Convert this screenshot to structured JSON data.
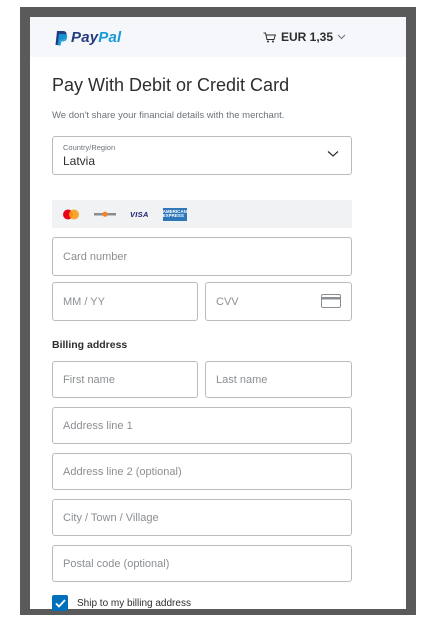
{
  "header": {
    "logo_pay": "Pay",
    "logo_pal": "Pal",
    "cart_total": "EUR 1,35",
    "colors": {
      "paypal_dark": "#253b80",
      "paypal_light": "#179bd7",
      "header_bg": "#f5f7fa"
    }
  },
  "form": {
    "title": "Pay With Debit or Credit Card",
    "subtitle": "We don't share your financial details with the merchant.",
    "country": {
      "label": "Country/Region",
      "value": "Latvia"
    },
    "card_brands": [
      "mastercard-icon",
      "discover-icon",
      "visa-icon",
      "amex-icon"
    ],
    "visa_label": "VISA",
    "amex_label": "AMERICAN EXPRESS",
    "card_number_placeholder": "Card number",
    "expiry_placeholder": "MM / YY",
    "cvv_placeholder": "CVV",
    "billing_title": "Billing address",
    "first_name_placeholder": "First name",
    "last_name_placeholder": "Last name",
    "address1_placeholder": "Address line 1",
    "address2_placeholder": "Address line 2 (optional)",
    "city_placeholder": "City / Town / Village",
    "postal_placeholder": "Postal code (optional)",
    "ship_to_billing": {
      "label": "Ship to my billing address",
      "checked": true
    },
    "colors": {
      "accent": "#0070ba",
      "border": "#b7bcbf"
    }
  }
}
